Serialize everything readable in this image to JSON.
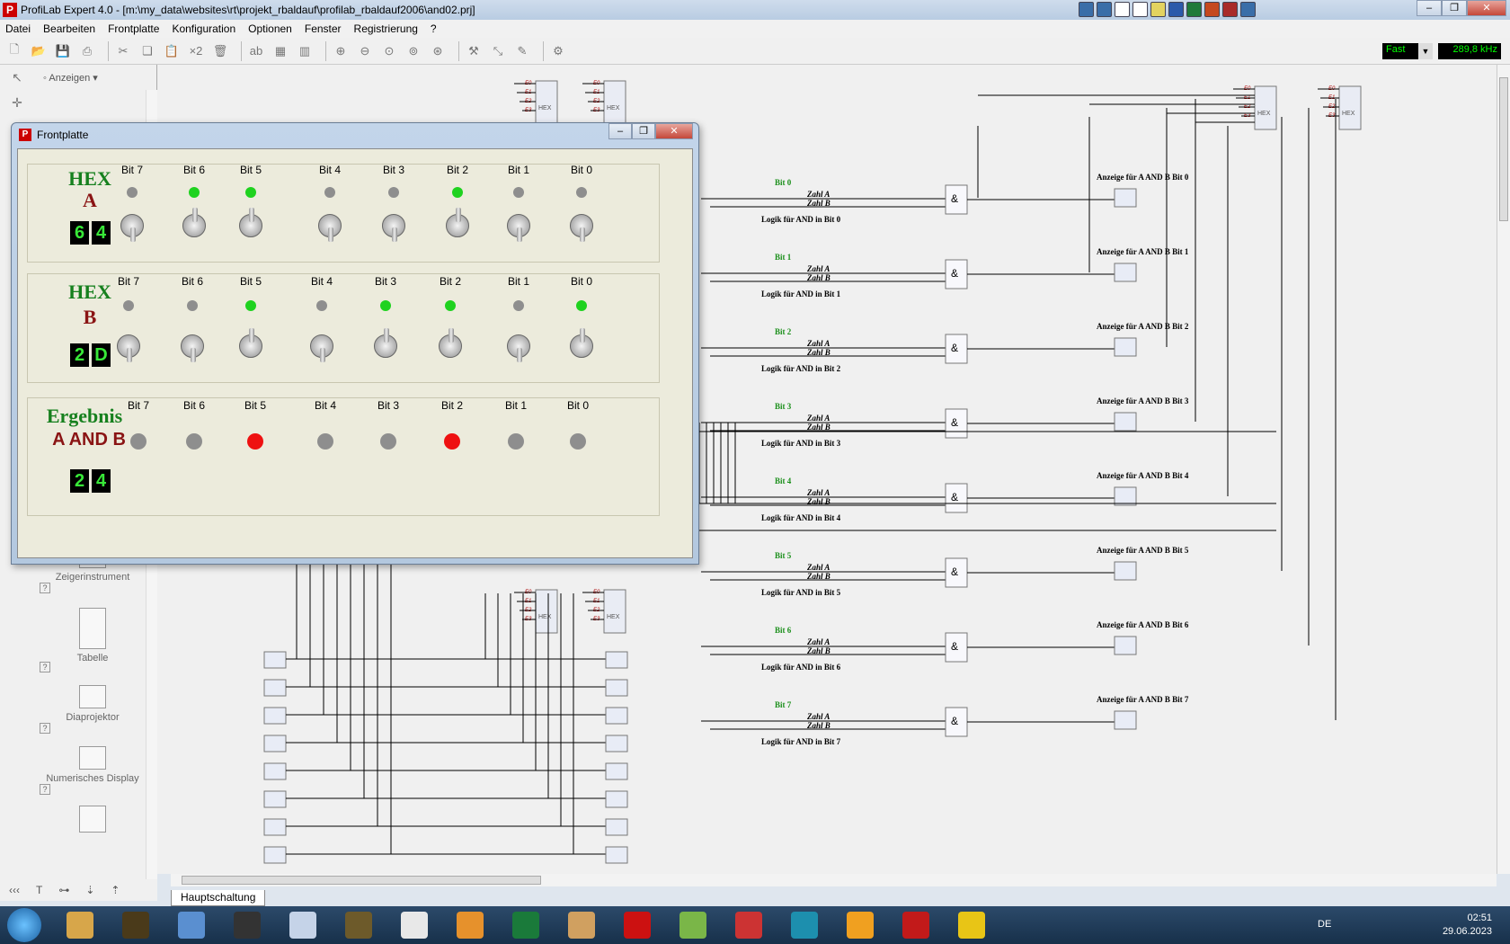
{
  "app": {
    "title": "ProfiLab Expert 4.0 - [m:\\my_data\\websites\\rt\\projekt_rbaldauf\\profilab_rbaldauf2006\\and02.prj]",
    "icon": "profilab-app-icon"
  },
  "menu": [
    "Datei",
    "Bearbeiten",
    "Frontplatte",
    "Konfiguration",
    "Optionen",
    "Fenster",
    "Registrierung",
    "?"
  ],
  "toolbar": {
    "zoom_label": "×2",
    "speed": "Fast",
    "frequency": "289,8 kHz",
    "icons": [
      "new-file-icon",
      "open-icon",
      "save-icon",
      "print-icon",
      "cut-icon",
      "copy-icon",
      "paste-icon",
      "delete-icon",
      "text-icon",
      "grid-icon",
      "zoom-in-icon",
      "zoom-out-icon",
      "zoom-fit-icon",
      "wire-icon",
      "settings-gear-icon"
    ]
  },
  "palette": {
    "filter_label": "Anzeigen",
    "items": [
      {
        "label": "Zeigerinstrument",
        "tag": "MI1"
      },
      {
        "label": "Tabelle",
        "tag": "TAB2"
      },
      {
        "label": "Diaprojektor",
        "tag": "PJ0"
      },
      {
        "label": "Numerisches Display",
        "tag": "ND2"
      }
    ]
  },
  "sheet_tab": "Hauptschaltung",
  "frontplatte": {
    "title": "Frontplatte",
    "panelA": {
      "hex_label": "HEX",
      "name": "A",
      "digits": [
        "6",
        "4"
      ],
      "bits": [
        {
          "label": "Bit 7",
          "on": false,
          "switch": "down"
        },
        {
          "label": "Bit 6",
          "on": true,
          "switch": "up"
        },
        {
          "label": "Bit 5",
          "on": true,
          "switch": "up"
        },
        {
          "label": "Bit 4",
          "on": false,
          "switch": "down"
        },
        {
          "label": "Bit 3",
          "on": false,
          "switch": "down"
        },
        {
          "label": "Bit 2",
          "on": true,
          "switch": "up"
        },
        {
          "label": "Bit 1",
          "on": false,
          "switch": "down"
        },
        {
          "label": "Bit 0",
          "on": false,
          "switch": "down"
        }
      ]
    },
    "panelB": {
      "hex_label": "HEX",
      "name": "B",
      "digits": [
        "2",
        "D"
      ],
      "bits": [
        {
          "label": "Bit 7",
          "on": false,
          "switch": "down"
        },
        {
          "label": "Bit 6",
          "on": false,
          "switch": "down"
        },
        {
          "label": "Bit 5",
          "on": true,
          "switch": "up"
        },
        {
          "label": "Bit 4",
          "on": false,
          "switch": "down"
        },
        {
          "label": "Bit 3",
          "on": true,
          "switch": "up"
        },
        {
          "label": "Bit 2",
          "on": true,
          "switch": "up"
        },
        {
          "label": "Bit 1",
          "on": false,
          "switch": "down"
        },
        {
          "label": "Bit 0",
          "on": true,
          "switch": "up"
        }
      ]
    },
    "panelResult": {
      "title": "Ergebnis",
      "subtitle": "A AND B",
      "digits": [
        "2",
        "4"
      ],
      "bits": [
        {
          "label": "Bit 7",
          "on": false
        },
        {
          "label": "Bit 6",
          "on": false
        },
        {
          "label": "Bit 5",
          "on": true
        },
        {
          "label": "Bit 4",
          "on": false
        },
        {
          "label": "Bit 3",
          "on": false
        },
        {
          "label": "Bit 2",
          "on": true
        },
        {
          "label": "Bit 1",
          "on": false
        },
        {
          "label": "Bit 0",
          "on": false
        }
      ]
    }
  },
  "schematic": {
    "rows": [
      {
        "bit": "Bit 0",
        "a": "Zahl A",
        "b": "Zahl B",
        "logic": "Logik für AND in Bit 0",
        "gate": "&",
        "gate_tag": "AND9",
        "disp": "Anzeige für A AND B Bit 0",
        "led_tag": "LED17"
      },
      {
        "bit": "Bit 1",
        "a": "Zahl A",
        "b": "Zahl B",
        "logic": "Logik für AND in Bit 1",
        "gate": "&",
        "gate_tag": "AND1",
        "disp": "Anzeige für A AND B Bit 1",
        "led_tag": "LED18"
      },
      {
        "bit": "Bit 2",
        "a": "Zahl A",
        "b": "Zahl B",
        "logic": "Logik für AND in Bit 2",
        "gate": "&",
        "gate_tag": "AND3",
        "disp": "Anzeige für A AND B Bit 2",
        "led_tag": "LED19"
      },
      {
        "bit": "Bit 3",
        "a": "Zahl A",
        "b": "Zahl B",
        "logic": "Logik für AND in Bit 3",
        "gate": "&",
        "gate_tag": "AND4",
        "disp": "Anzeige für A AND B Bit 3",
        "led_tag": "LED20"
      },
      {
        "bit": "Bit 4",
        "a": "Zahl A",
        "b": "Zahl B",
        "logic": "Logik für AND in Bit 4",
        "gate": "&",
        "gate_tag": "AND5",
        "disp": "Anzeige für A AND B Bit 4",
        "led_tag": "LED21"
      },
      {
        "bit": "Bit 5",
        "a": "Zahl A",
        "b": "Zahl B",
        "logic": "Logik für AND in Bit 5",
        "gate": "&",
        "gate_tag": "AND6",
        "disp": "Anzeige für A AND B Bit 5",
        "led_tag": "LED22"
      },
      {
        "bit": "Bit 6",
        "a": "Zahl A",
        "b": "Zahl B",
        "logic": "Logik für AND in Bit 6",
        "gate": "&",
        "gate_tag": "AND7",
        "disp": "Anzeige für A AND B Bit 6",
        "led_tag": "LED23"
      },
      {
        "bit": "Bit 7",
        "a": "Zahl A",
        "b": "Zahl B",
        "logic": "Logik für AND in Bit 7",
        "gate": "&",
        "gate_tag": "AND8",
        "disp": "Anzeige für A AND B Bit 7",
        "led_tag": "LED24"
      }
    ],
    "hex_blocks": [
      {
        "title": "HEX",
        "tag": "HD1"
      },
      {
        "title": "HEX",
        "tag": "HD2"
      },
      {
        "title": "HEX",
        "tag": "HD5"
      },
      {
        "title": "HEX",
        "tag": "HD6"
      },
      {
        "title": "HEX",
        "tag": "HD3"
      },
      {
        "title": "HEX",
        "tag": "HD4"
      }
    ],
    "hex_pins": [
      "E0",
      "E1",
      "E2",
      "E3"
    ],
    "switches": [
      "S15",
      "S16",
      "S14",
      "S13",
      "S12",
      "S11",
      "S10",
      "S9"
    ],
    "leds": [
      "LED16",
      "LED15",
      "LED14",
      "LED13",
      "LED12",
      "LED11",
      "LED10",
      "LED9"
    ]
  },
  "taskbar": {
    "lang": "DE",
    "time": "02:51",
    "date": "29.06.2023",
    "apps": [
      "explorer-icon",
      "gear-app-icon",
      "notepad-icon",
      "tool-icon",
      "calculator-icon",
      "globe-icon",
      "chrome-icon",
      "media-player-icon",
      "maple-icon",
      "paint-icon",
      "profilab-icon",
      "spreadsheet-icon",
      "paint-bucket-icon",
      "arduino-icon",
      "notes-icon",
      "red-app-icon",
      "check-app-icon"
    ]
  },
  "colors": {
    "led_on_green": "#1fd21f",
    "led_on_red": "#ee1111",
    "led_off": "#8e8e8e",
    "display_digit": "#38e838",
    "hex_label_green": "#16801e",
    "hex_label_red": "#8a1414"
  }
}
